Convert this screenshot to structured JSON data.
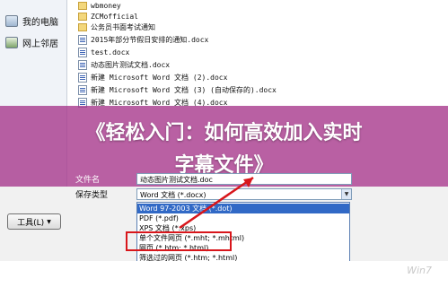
{
  "sidebar": {
    "items": [
      {
        "label": "我的电脑",
        "icon": "computer-icon"
      },
      {
        "label": "网上邻居",
        "icon": "network-icon"
      }
    ]
  },
  "files": [
    {
      "name": "wbmoney",
      "icon": "folder-icon"
    },
    {
      "name": "ZCMofficial",
      "icon": "folder-icon"
    },
    {
      "name": "公务员书面考试通知",
      "icon": "folder-icon"
    },
    {
      "name": "2015年部分节假日安排的通知.docx",
      "icon": "word-doc-icon"
    },
    {
      "name": "test.docx",
      "icon": "word-doc-icon"
    },
    {
      "name": "动态图片测试文档.docx",
      "icon": "word-doc-icon"
    },
    {
      "name": "新建 Microsoft Word 文档 (2).docx",
      "icon": "word-doc-icon"
    },
    {
      "name": "新建 Microsoft Word 文档 (3) (自动保存的).docx",
      "icon": "word-doc-icon"
    },
    {
      "name": "新建 Microsoft Word 文档 (4).docx",
      "icon": "word-doc-icon"
    }
  ],
  "banner": {
    "line1": "《轻松入门：如何高效加入实时",
    "line2": "字幕文件》"
  },
  "save_form": {
    "filename_label": "文件名",
    "filename_value": "动态图片测试文档.doc",
    "filetype_label": "保存类型",
    "filetype_value": "Word 文档 (*.docx)",
    "tools_label": "工具(L)"
  },
  "filetype_options": [
    "Word 97-2003 文档 (*.dot)",
    "PDF (*.pdf)",
    "XPS 文档 (*.xps)",
    "单个文件网页 (*.mht; *.mhtml)",
    "网页 (*.htm; *.html)",
    "筛选过的网页 (*.htm; *.html)"
  ],
  "selected_option_index": 0,
  "colors": {
    "banner": "#a8388c",
    "highlight": "#d8161b",
    "selection": "#3169c6"
  },
  "watermark": "Win7"
}
